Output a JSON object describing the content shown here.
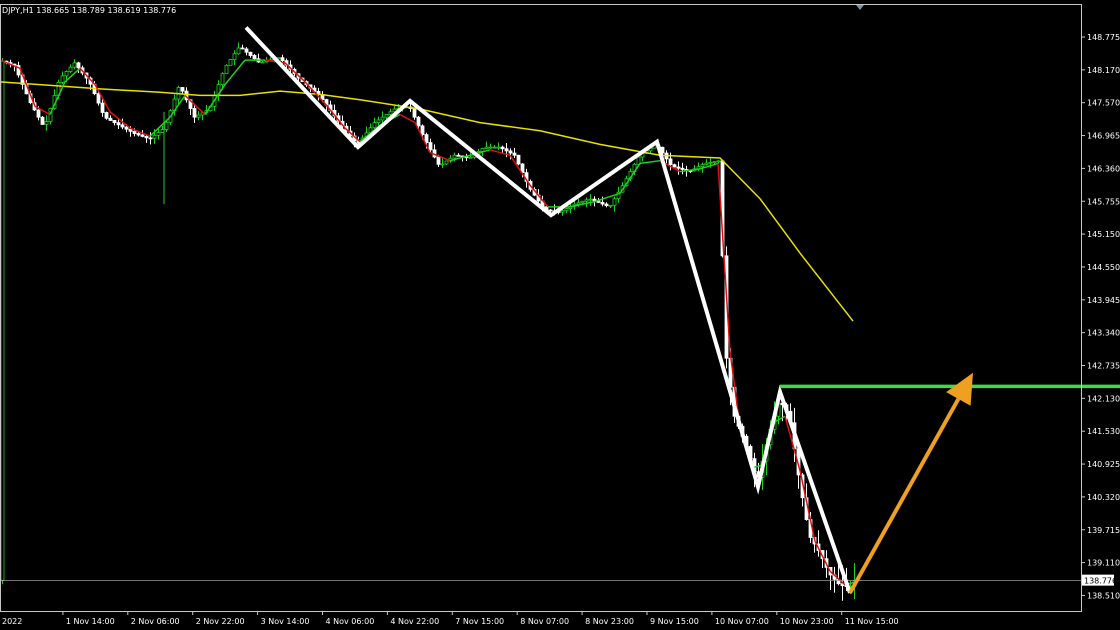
{
  "header": {
    "symbol_info": "DJPY,H1 138.665 138.789 138.619 138.776"
  },
  "colors": {
    "background": "#000000",
    "frame": "#c8c8c8",
    "bull_candle": "#22d022",
    "bear_candle": "#ffffff",
    "ma_slow": "#e8e000",
    "ma_fast_green": "#22d022",
    "ma_fast_red": "#e01010",
    "pattern": "#ffffff",
    "resistance": "#44d844",
    "projection": "#f0a020",
    "price_marker_bg": "#ffffff",
    "price_marker_text": "#000000"
  },
  "chart_data": {
    "type": "candlestick",
    "title": "",
    "timeframe": "H1",
    "y_range": [
      138.25,
      149.3
    ],
    "y_ticks": [
      "148.775",
      "148.170",
      "147.570",
      "146.965",
      "146.360",
      "145.755",
      "145.150",
      "144.550",
      "143.945",
      "143.340",
      "142.735",
      "142.130",
      "141.530",
      "140.925",
      "140.320",
      "139.715",
      "139.110",
      "138.510"
    ],
    "x_ticks": [
      "2022",
      "1 Nov 14:00",
      "2 Nov 06:00",
      "2 Nov 22:00",
      "3 Nov 14:00",
      "4 Nov 06:00",
      "4 Nov 22:00",
      "7 Nov 15:00",
      "8 Nov 07:00",
      "8 Nov 23:00",
      "9 Nov 15:00",
      "10 Nov 07:00",
      "10 Nov 23:00",
      "11 Nov 15:00"
    ],
    "current_price": "138.776",
    "price_line": 138.776,
    "slow_ma": [
      [
        0,
        147.95
      ],
      [
        40,
        147.9
      ],
      [
        100,
        147.82
      ],
      [
        160,
        147.76
      ],
      [
        200,
        147.7
      ],
      [
        240,
        147.7
      ],
      [
        280,
        147.78
      ],
      [
        320,
        147.72
      ],
      [
        360,
        147.62
      ],
      [
        420,
        147.45
      ],
      [
        480,
        147.2
      ],
      [
        540,
        147.05
      ],
      [
        600,
        146.8
      ],
      [
        660,
        146.6
      ],
      [
        720,
        146.55
      ],
      [
        760,
        145.8
      ],
      [
        800,
        144.8
      ],
      [
        853,
        143.55
      ]
    ],
    "zigzag": [
      [
        246,
        148.95
      ],
      [
        358,
        146.75
      ],
      [
        410,
        147.6
      ],
      [
        551,
        145.5
      ],
      [
        657,
        146.85
      ],
      [
        758,
        140.5
      ],
      [
        780,
        142.25
      ],
      [
        850,
        138.55
      ]
    ],
    "resistance_level": 142.35,
    "resistance_x": [
      780,
      1120
    ],
    "projection_arrow": [
      [
        850,
        138.55
      ],
      [
        973,
        142.6
      ]
    ],
    "price_path": [
      [
        0,
        148.35
      ],
      [
        15,
        148.25
      ],
      [
        30,
        147.6
      ],
      [
        45,
        147.1
      ],
      [
        60,
        148.0
      ],
      [
        75,
        148.3
      ],
      [
        90,
        147.95
      ],
      [
        105,
        147.3
      ],
      [
        120,
        147.15
      ],
      [
        135,
        147.0
      ],
      [
        150,
        146.9
      ],
      [
        165,
        147.1
      ],
      [
        180,
        147.9
      ],
      [
        195,
        147.3
      ],
      [
        210,
        147.45
      ],
      [
        225,
        148.2
      ],
      [
        240,
        148.6
      ],
      [
        260,
        148.3
      ],
      [
        280,
        148.4
      ],
      [
        300,
        148.0
      ],
      [
        320,
        147.7
      ],
      [
        340,
        147.2
      ],
      [
        358,
        146.8
      ],
      [
        375,
        147.2
      ],
      [
        395,
        147.45
      ],
      [
        410,
        147.5
      ],
      [
        425,
        146.9
      ],
      [
        440,
        146.4
      ],
      [
        455,
        146.6
      ],
      [
        470,
        146.55
      ],
      [
        485,
        146.75
      ],
      [
        500,
        146.75
      ],
      [
        515,
        146.6
      ],
      [
        530,
        146.0
      ],
      [
        545,
        145.6
      ],
      [
        560,
        145.55
      ],
      [
        575,
        145.7
      ],
      [
        590,
        145.8
      ],
      [
        610,
        145.65
      ],
      [
        625,
        146.1
      ],
      [
        640,
        146.6
      ],
      [
        657,
        146.8
      ],
      [
        672,
        146.4
      ],
      [
        690,
        146.3
      ],
      [
        705,
        146.45
      ],
      [
        720,
        146.5
      ],
      [
        726,
        143.0
      ],
      [
        735,
        141.8
      ],
      [
        748,
        141.2
      ],
      [
        758,
        140.6
      ],
      [
        770,
        141.5
      ],
      [
        780,
        142.1
      ],
      [
        790,
        141.8
      ],
      [
        800,
        140.6
      ],
      [
        810,
        139.6
      ],
      [
        820,
        139.3
      ],
      [
        830,
        138.9
      ],
      [
        840,
        138.7
      ],
      [
        850,
        138.65
      ],
      [
        855,
        138.78
      ]
    ],
    "ma_fast": [
      [
        0,
        148.35
      ],
      [
        20,
        148.2
      ],
      [
        35,
        147.5
      ],
      [
        50,
        147.35
      ],
      [
        65,
        147.95
      ],
      [
        80,
        148.2
      ],
      [
        95,
        147.9
      ],
      [
        110,
        147.4
      ],
      [
        130,
        147.1
      ],
      [
        150,
        146.95
      ],
      [
        170,
        147.3
      ],
      [
        185,
        147.7
      ],
      [
        205,
        147.35
      ],
      [
        225,
        147.9
      ],
      [
        245,
        148.35
      ],
      [
        265,
        148.35
      ],
      [
        285,
        148.3
      ],
      [
        305,
        147.95
      ],
      [
        325,
        147.55
      ],
      [
        345,
        147.1
      ],
      [
        360,
        146.85
      ],
      [
        380,
        147.15
      ],
      [
        400,
        147.35
      ],
      [
        415,
        147.2
      ],
      [
        430,
        146.65
      ],
      [
        450,
        146.5
      ],
      [
        470,
        146.6
      ],
      [
        490,
        146.7
      ],
      [
        510,
        146.6
      ],
      [
        530,
        146.05
      ],
      [
        548,
        145.65
      ],
      [
        570,
        145.65
      ],
      [
        595,
        145.75
      ],
      [
        620,
        145.9
      ],
      [
        640,
        146.45
      ],
      [
        660,
        146.5
      ],
      [
        680,
        146.3
      ],
      [
        700,
        146.35
      ],
      [
        718,
        146.45
      ],
      [
        730,
        143.0
      ],
      [
        740,
        141.6
      ],
      [
        752,
        140.85
      ],
      [
        762,
        140.9
      ],
      [
        775,
        141.7
      ],
      [
        785,
        141.8
      ],
      [
        800,
        140.8
      ],
      [
        815,
        139.5
      ],
      [
        830,
        138.95
      ],
      [
        845,
        138.7
      ],
      [
        855,
        138.75
      ]
    ]
  }
}
